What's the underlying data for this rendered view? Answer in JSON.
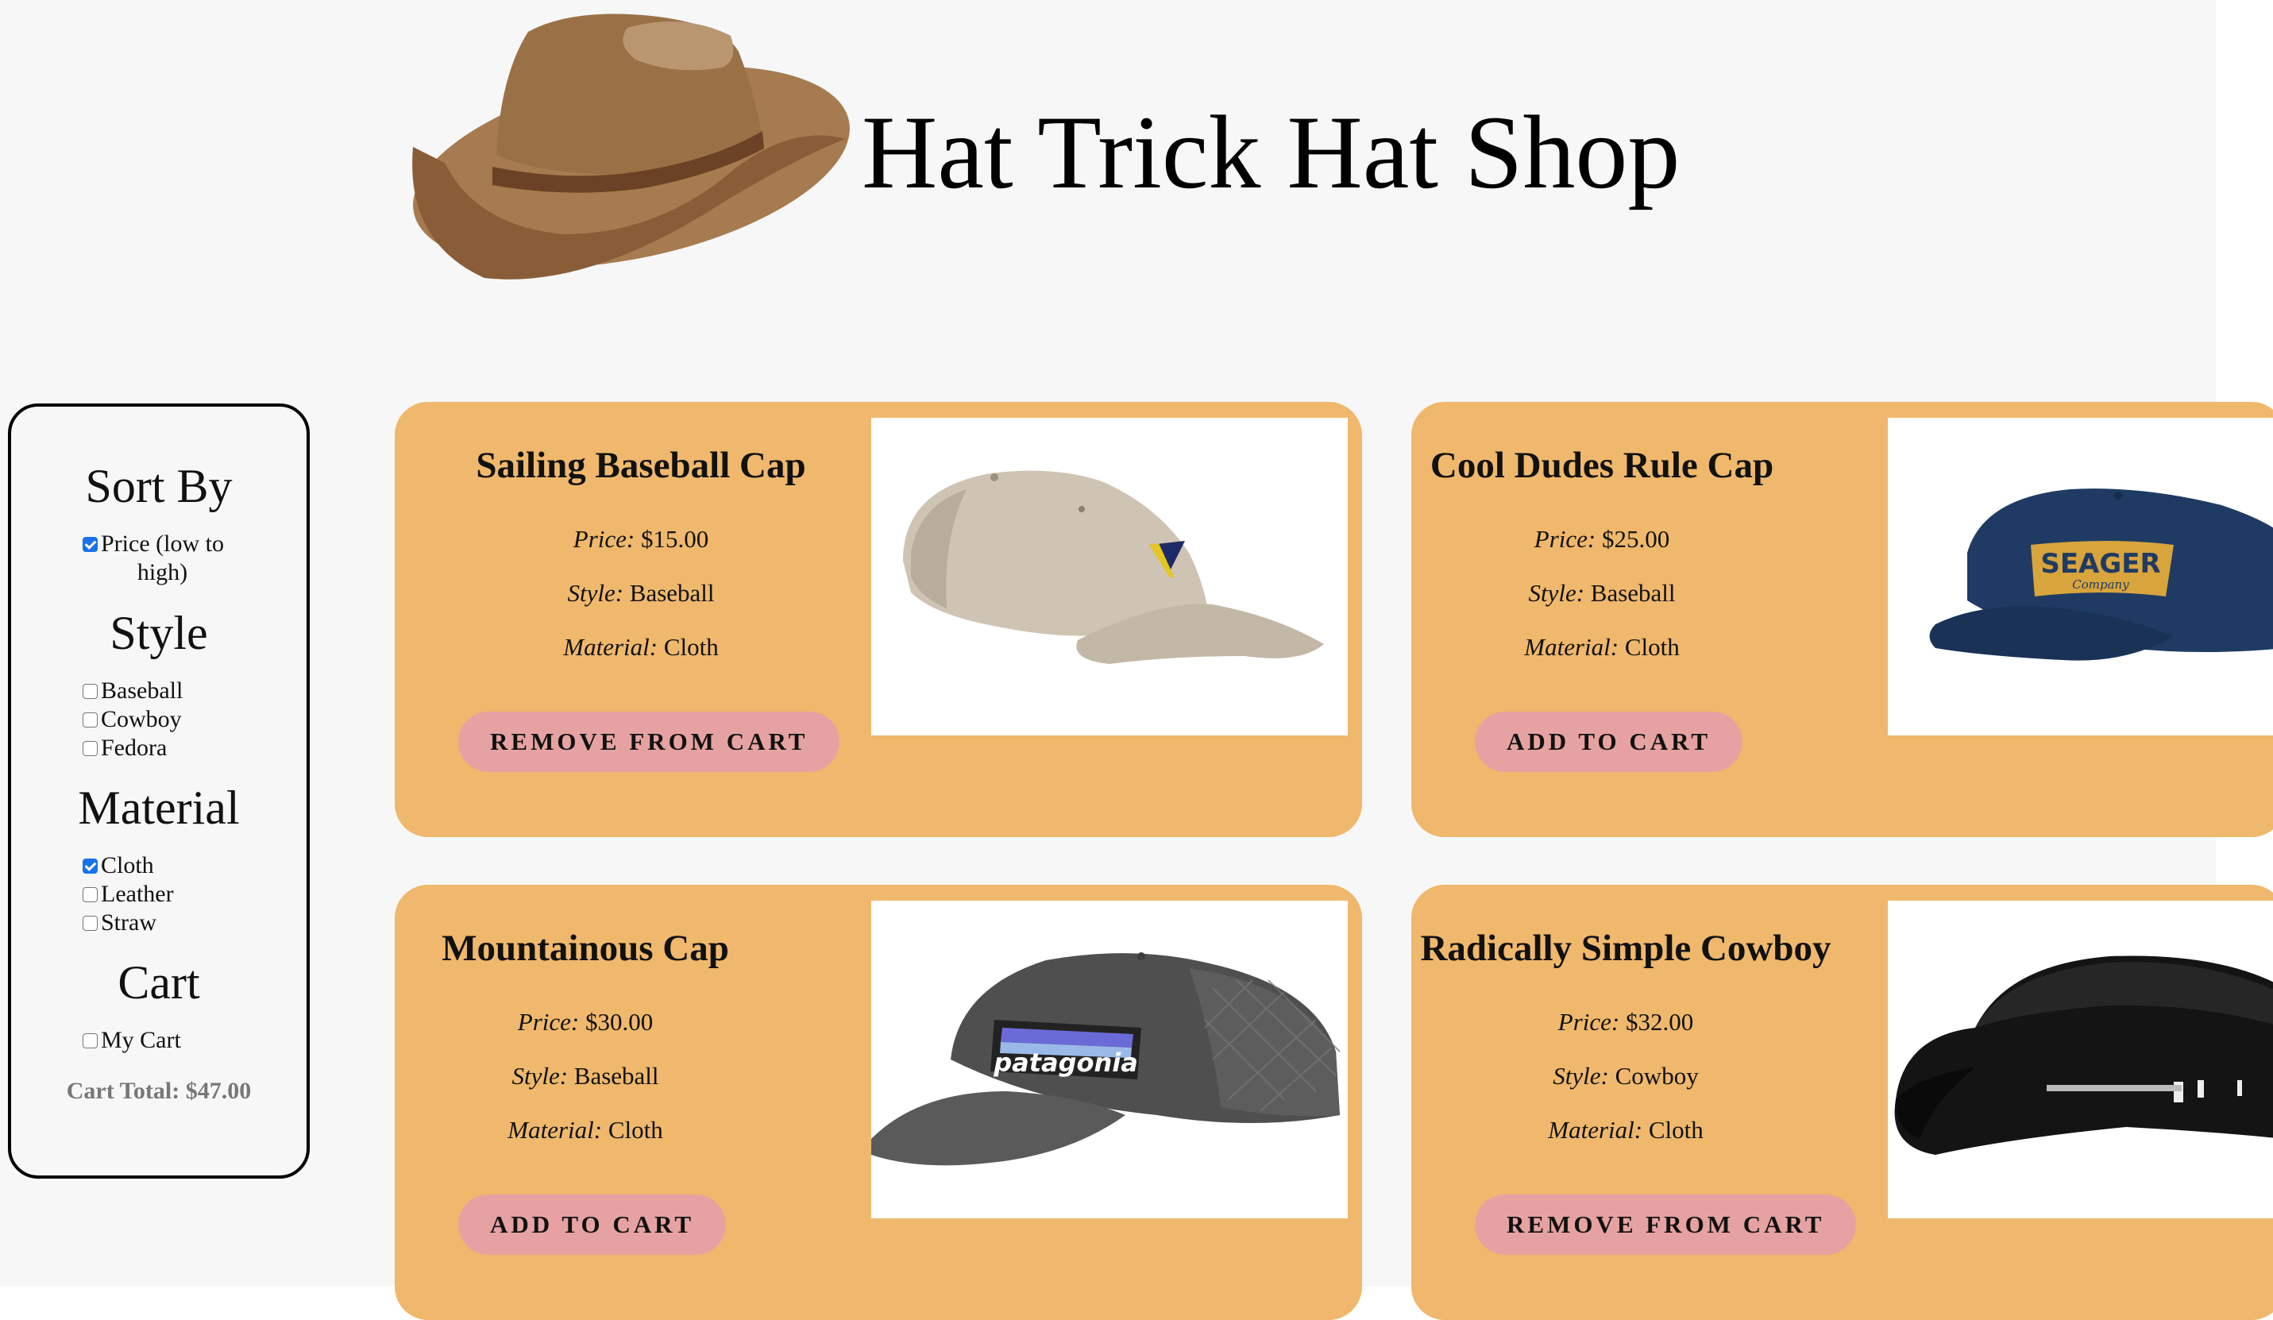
{
  "header": {
    "title": "Hat Trick Hat Shop",
    "logo_icon": "cowboy-hat-icon"
  },
  "sidebar": {
    "sort_heading": "Sort By",
    "sort_options": [
      {
        "label": "Price (low to high)",
        "line1": "Price (low to",
        "line2": "high)",
        "checked": true
      }
    ],
    "style_heading": "Style",
    "style_options": [
      {
        "label": "Baseball",
        "checked": false
      },
      {
        "label": "Cowboy",
        "checked": false
      },
      {
        "label": "Fedora",
        "checked": false
      }
    ],
    "material_heading": "Material",
    "material_options": [
      {
        "label": "Cloth",
        "checked": true
      },
      {
        "label": "Leather",
        "checked": false
      },
      {
        "label": "Straw",
        "checked": false
      }
    ],
    "cart_heading": "Cart",
    "cart_options": [
      {
        "label": "My Cart",
        "checked": false
      }
    ],
    "cart_total": "Cart Total: $47.00"
  },
  "labels": {
    "price": "Price:",
    "style": "Style:",
    "material": "Material:"
  },
  "products": [
    {
      "name": "Sailing Baseball Cap",
      "price": "$15.00",
      "style": "Baseball",
      "material": "Cloth",
      "button": "REMOVE FROM CART",
      "in_cart": true,
      "image_icon": "khaki-baseball-cap-icon"
    },
    {
      "name": "Cool Dudes Rule Cap",
      "price": "$25.00",
      "style": "Baseball",
      "material": "Cloth",
      "button": "ADD TO CART",
      "in_cart": false,
      "image_icon": "navy-snapback-cap-icon",
      "image_text": "SEAGER",
      "image_subtext": "Company"
    },
    {
      "name": "Mountainous Cap",
      "price": "$30.00",
      "style": "Baseball",
      "material": "Cloth",
      "button": "ADD TO CART",
      "in_cart": false,
      "image_icon": "grey-trucker-cap-icon",
      "image_text": "patagonia"
    },
    {
      "name": "Radically Simple Cowboy",
      "price": "$32.00",
      "style": "Cowboy",
      "material": "Cloth",
      "button": "REMOVE FROM CART",
      "in_cart": true,
      "image_icon": "black-cowboy-hat-icon"
    }
  ],
  "colors": {
    "card_bg": "#efb86c",
    "button_bg": "#e6a2a2",
    "page_bg": "#f7f7f7",
    "checkbox_checked": "#1a73e8"
  }
}
